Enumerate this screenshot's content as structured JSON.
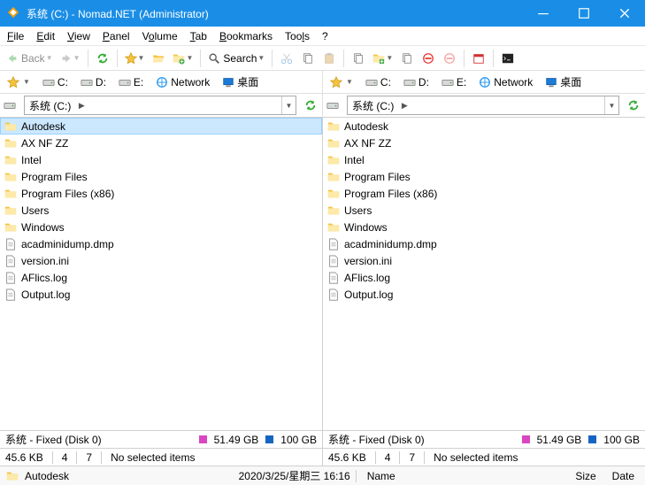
{
  "window": {
    "title": "系统 (C:) - Nomad.NET (Administrator)"
  },
  "menu": {
    "file": "File",
    "edit": "Edit",
    "view": "View",
    "panel": "Panel",
    "volume": "Volume",
    "tab": "Tab",
    "bookmarks": "Bookmarks",
    "tools": "Tools",
    "help": "?"
  },
  "toolbar": {
    "back": "Back",
    "search": "Search"
  },
  "drives": [
    {
      "label": "C:",
      "type": "hdd"
    },
    {
      "label": "D:",
      "type": "hdd"
    },
    {
      "label": "E:",
      "type": "hdd"
    },
    {
      "label": "Network",
      "type": "net"
    },
    {
      "label": "桌面",
      "type": "desktop"
    }
  ],
  "path": {
    "root": "系统 (C:)"
  },
  "left": {
    "items": [
      {
        "name": "Autodesk",
        "type": "folder",
        "selected": true
      },
      {
        "name": "AX NF ZZ",
        "type": "folder"
      },
      {
        "name": "Intel",
        "type": "folder"
      },
      {
        "name": "Program Files",
        "type": "folder"
      },
      {
        "name": "Program Files (x86)",
        "type": "folder"
      },
      {
        "name": "Users",
        "type": "folder"
      },
      {
        "name": "Windows",
        "type": "folder"
      },
      {
        "name": "acadminidump.dmp",
        "type": "file"
      },
      {
        "name": "version.ini",
        "type": "file"
      },
      {
        "name": "AFlics.log",
        "type": "file"
      },
      {
        "name": "Output.log",
        "type": "file"
      }
    ],
    "status": {
      "disk": "系统 - Fixed (Disk 0)",
      "free": "51.49 GB",
      "total": "100 GB"
    },
    "sel": {
      "size": "45.6 KB",
      "files": "4",
      "folders": "7",
      "msg": "No selected items"
    }
  },
  "right": {
    "items": [
      {
        "name": "Autodesk",
        "type": "folder"
      },
      {
        "name": "AX NF ZZ",
        "type": "folder"
      },
      {
        "name": "Intel",
        "type": "folder"
      },
      {
        "name": "Program Files",
        "type": "folder"
      },
      {
        "name": "Program Files (x86)",
        "type": "folder"
      },
      {
        "name": "Users",
        "type": "folder"
      },
      {
        "name": "Windows",
        "type": "folder"
      },
      {
        "name": "acadminidump.dmp",
        "type": "file"
      },
      {
        "name": "version.ini",
        "type": "file"
      },
      {
        "name": "AFlics.log",
        "type": "file"
      },
      {
        "name": "Output.log",
        "type": "file"
      }
    ],
    "status": {
      "disk": "系统 - Fixed (Disk 0)",
      "free": "51.49 GB",
      "total": "100 GB"
    },
    "sel": {
      "size": "45.6 KB",
      "files": "4",
      "folders": "7",
      "msg": "No selected items"
    }
  },
  "bottom": {
    "name": "Autodesk",
    "date": "2020/3/25/星期三 16:16",
    "name_col": "Name",
    "size_col": "Size",
    "date_col": "Date"
  }
}
